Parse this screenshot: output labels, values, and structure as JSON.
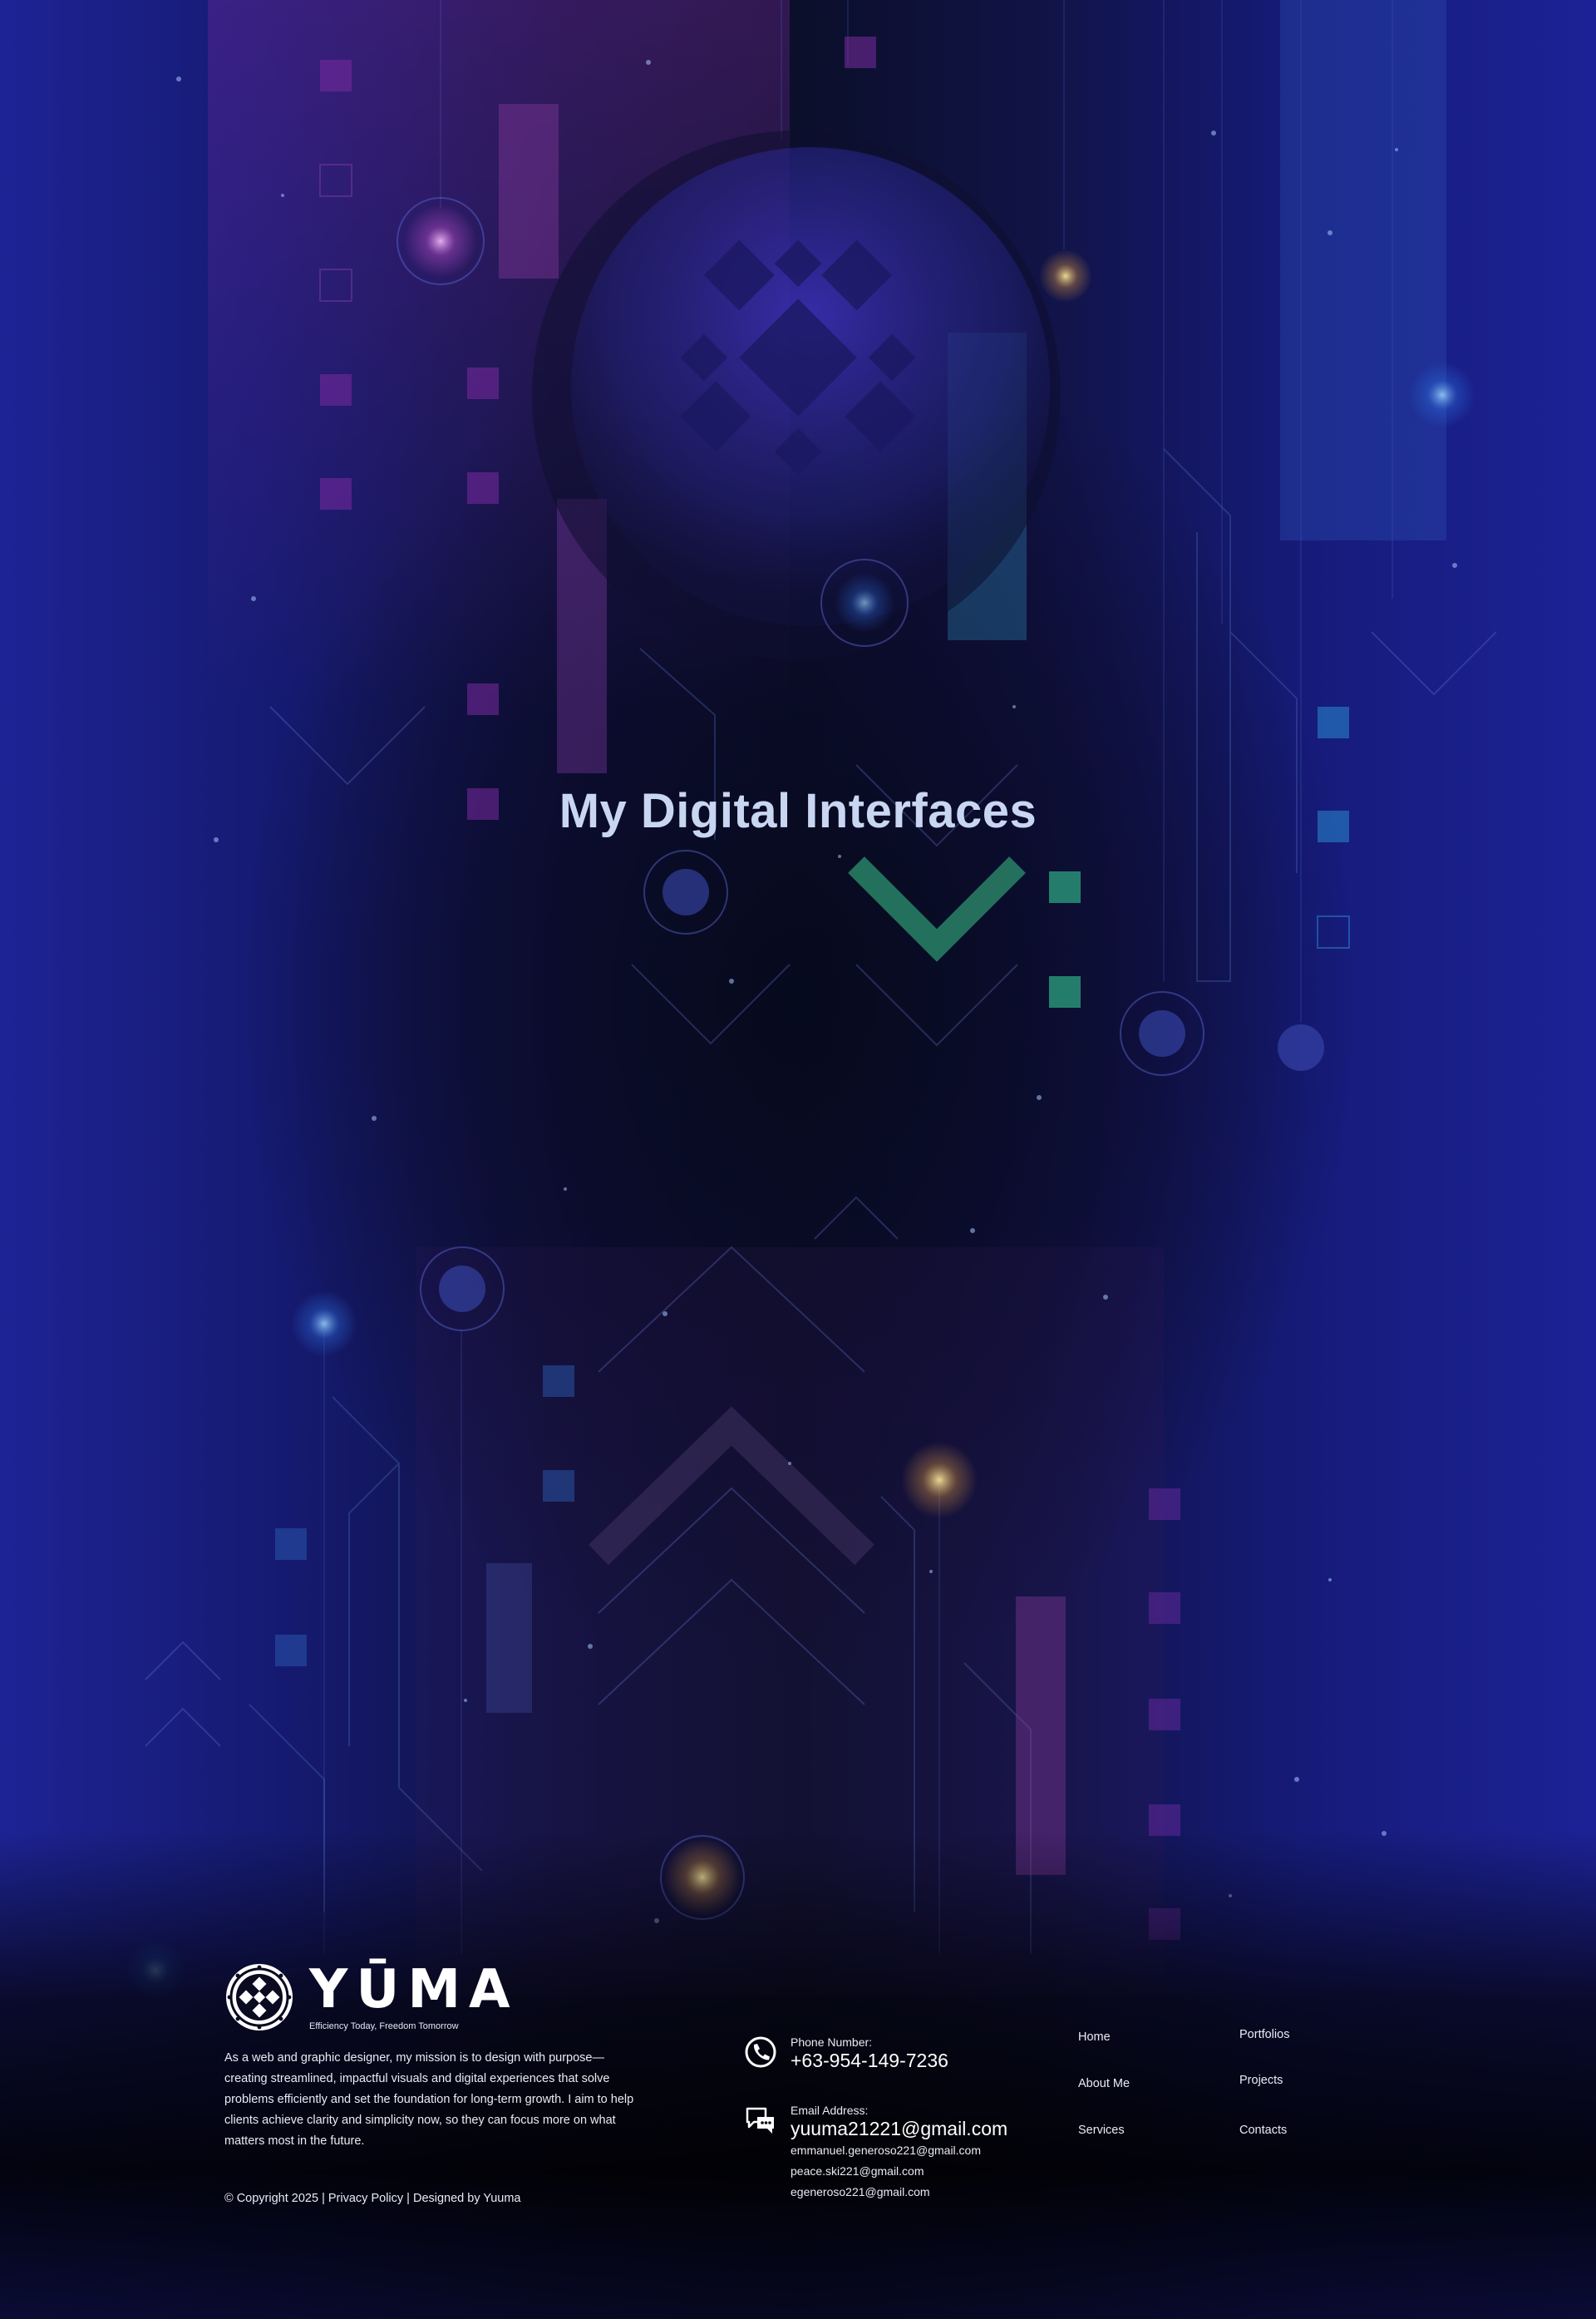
{
  "hero": {
    "title": "My Digital Interfaces"
  },
  "footer": {
    "brand": {
      "name": "YŪMA",
      "tagline": "Efficiency Today, Freedom Tomorrow",
      "logo_icon": "mandala-seal-icon"
    },
    "mission": "As a web and graphic designer, my mission is to design with purpose—creating streamlined, impactful visuals and digital experiences that solve problems efficiently and set the foundation for long-term growth. I aim to help clients achieve clarity and simplicity now, so they can focus more on what matters most in the future.",
    "copyright": {
      "text": "© Copyright 2025",
      "separator": " | ",
      "privacy": "Privacy Policy",
      "designed_by": "Designed by Yuuma"
    },
    "contact": {
      "phone": {
        "icon": "phone-icon",
        "label": "Phone Number:",
        "value": "+63-954-149-7236"
      },
      "email": {
        "icon": "chat-bubbles-icon",
        "label": "Email Address:",
        "primary": "yuuma21221@gmail.com",
        "others": [
          "emmanuel.generoso221@gmail.com",
          "peace.ski221@gmail.com",
          "egeneroso221@gmail.com"
        ]
      }
    },
    "nav": {
      "home": "Home",
      "about": "About Me",
      "services": "Services",
      "portfolios": "Portfolios",
      "projects": "Projects",
      "contacts": "Contacts"
    }
  },
  "colors": {
    "bg_edge": "#1d2394",
    "bg_center": "#0b0f2a",
    "title": "#c9d6f2",
    "accent_green": "#2f8a6a",
    "accent_purple": "#6a2a8a"
  }
}
